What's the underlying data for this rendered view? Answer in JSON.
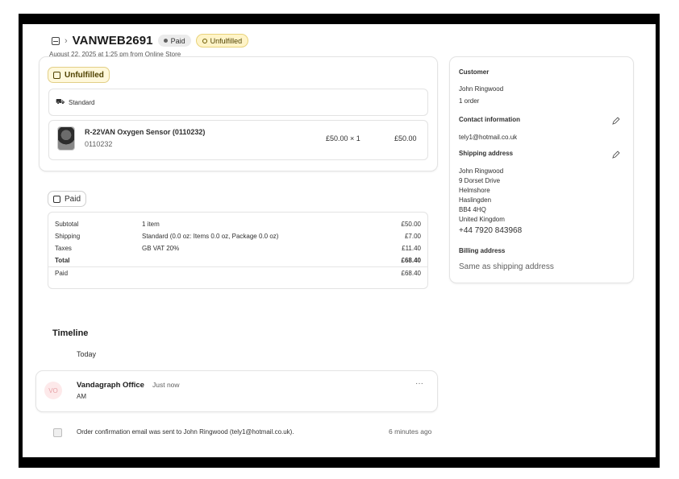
{
  "order": {
    "title": "VANWEB2691",
    "paid_badge": "Paid",
    "fulfillment_badge": "Unfulfilled",
    "subtitle": "August 22, 2025 at 1:25 pm from Online Store"
  },
  "fulfillment": {
    "status_tag": "Unfulfilled",
    "shipping_method": "Standard",
    "item": {
      "name": "R-22VAN Oxygen Sensor (0110232)",
      "sku": "0110232",
      "unit_price_qty": "£50.00 ×  1",
      "total": "£50.00"
    }
  },
  "payment": {
    "status_tag": "Paid",
    "rows": [
      {
        "label": "Subtotal",
        "detail": "1 item",
        "amount": "£50.00"
      },
      {
        "label": "Shipping",
        "detail": "Standard (0.0 oz: Items 0.0 oz, Package 0.0 oz)",
        "amount": "£7.00"
      },
      {
        "label": "Taxes",
        "detail": "GB VAT 20%",
        "amount": "£11.40"
      },
      {
        "label": "Total",
        "detail": "",
        "amount": "£68.40"
      },
      {
        "label": "Paid",
        "detail": "",
        "amount": "£68.40"
      }
    ]
  },
  "timeline": {
    "heading": "Timeline",
    "day": "Today",
    "comment": {
      "avatar_initials": "VO",
      "author": "Vandagraph Office",
      "time": "Just now",
      "body": "AM",
      "more": "···"
    },
    "event": {
      "text": "Order confirmation email was sent to John Ringwood (tely1@hotmail.co.uk).",
      "time": "6 minutes ago"
    }
  },
  "customer": {
    "heading": "Customer",
    "name": "John Ringwood",
    "orders": "1 order",
    "contact_heading": "Contact information",
    "email": "tely1@hotmail.co.uk",
    "shipping_heading": "Shipping address",
    "address_lines": [
      "John Ringwood",
      "9 Dorset Drive",
      "Helmshore",
      "Haslingden",
      "BB4 4HQ",
      "United Kingdom"
    ],
    "phone": "+44 7920 843968",
    "billing_heading": "Billing address",
    "billing_value": "Same as shipping address"
  }
}
